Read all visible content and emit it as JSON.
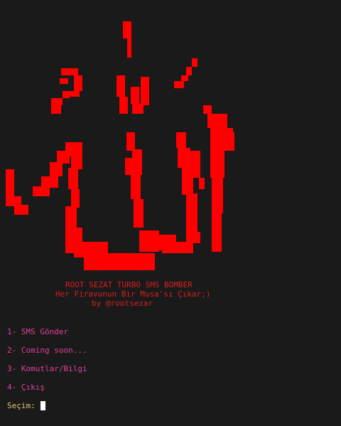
{
  "colors": {
    "background": "#1a1a1a",
    "art": "#ff0000",
    "banner": "#d81e1e",
    "menu": "#e0409a",
    "prompt": "#e8c070",
    "cursor": "#ffffff"
  },
  "banner": {
    "title": "ROOT SEZAT TURBO SMS BOMBER",
    "subtitle": "Her Firavunun Bir Musa'sı Çıkar;)",
    "author": "by @rootsezar"
  },
  "menu": {
    "items": [
      {
        "label": "1- SMS Gönder"
      },
      {
        "label": "2- Coming soon..."
      },
      {
        "label": "3- Komutlar/Bilgi"
      },
      {
        "label": "4- Çıkış"
      }
    ]
  },
  "prompt": {
    "label": "Seçim:",
    "value": ""
  }
}
